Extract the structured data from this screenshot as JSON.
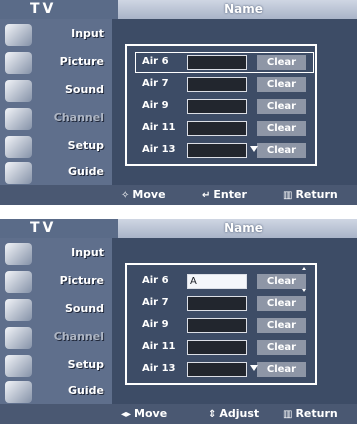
{
  "screens": [
    {
      "tv_label": "TV",
      "title": "Name",
      "menu": [
        {
          "label": "Input",
          "icon": "input-icon"
        },
        {
          "label": "Picture",
          "icon": "picture-icon"
        },
        {
          "label": "Sound",
          "icon": "sound-icon"
        },
        {
          "label": "Channel",
          "icon": "channel-icon"
        },
        {
          "label": "Setup",
          "icon": "setup-icon"
        },
        {
          "label": "Guide",
          "icon": "guide-icon"
        }
      ],
      "rows": [
        {
          "name": "Air 6",
          "value": "",
          "clear": "Clear"
        },
        {
          "name": "Air 7",
          "value": "",
          "clear": "Clear"
        },
        {
          "name": "Air 9",
          "value": "",
          "clear": "Clear"
        },
        {
          "name": "Air 11",
          "value": "",
          "clear": "Clear"
        },
        {
          "name": "Air 13",
          "value": "",
          "clear": "Clear"
        }
      ],
      "footer": {
        "move": "Move",
        "second": "Enter",
        "return": "Return"
      }
    },
    {
      "tv_label": "TV",
      "title": "Name",
      "menu": [
        {
          "label": "Input",
          "icon": "input-icon"
        },
        {
          "label": "Picture",
          "icon": "picture-icon"
        },
        {
          "label": "Sound",
          "icon": "sound-icon"
        },
        {
          "label": "Channel",
          "icon": "channel-icon"
        },
        {
          "label": "Setup",
          "icon": "setup-icon"
        },
        {
          "label": "Guide",
          "icon": "guide-icon"
        }
      ],
      "rows": [
        {
          "name": "Air 6",
          "value": "A",
          "clear": "Clear"
        },
        {
          "name": "Air 7",
          "value": "",
          "clear": "Clear"
        },
        {
          "name": "Air 9",
          "value": "",
          "clear": "Clear"
        },
        {
          "name": "Air 11",
          "value": "",
          "clear": "Clear"
        },
        {
          "name": "Air 13",
          "value": "",
          "clear": "Clear"
        }
      ],
      "footer": {
        "move": "Move",
        "second": "Adjust",
        "return": "Return"
      }
    }
  ]
}
